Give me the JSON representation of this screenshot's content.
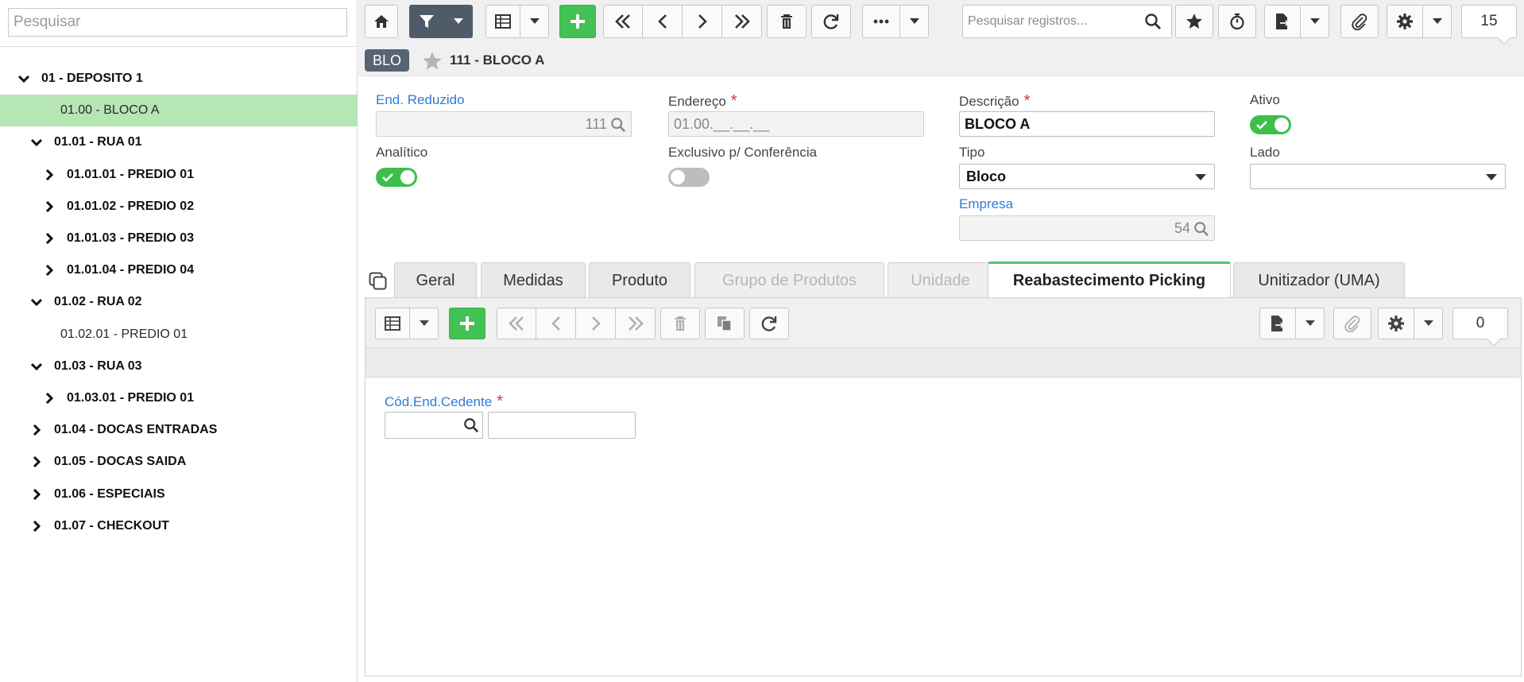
{
  "sidebar": {
    "search_placeholder": "Pesquisar",
    "tree": [
      {
        "label": "01 - DEPOSITO 1",
        "expanded": true,
        "bold": true,
        "level": 0
      },
      {
        "label": "01.00 - BLOCO A",
        "selected": true,
        "bold": false,
        "level": 1
      },
      {
        "label": "01.01 - RUA 01",
        "expanded": true,
        "bold": true,
        "level": 1
      },
      {
        "label": "01.01.01 - PREDIO 01",
        "expanded": false,
        "bold": true,
        "level": 2
      },
      {
        "label": "01.01.02 - PREDIO 02",
        "expanded": false,
        "bold": true,
        "level": 2
      },
      {
        "label": "01.01.03 - PREDIO 03",
        "expanded": false,
        "bold": true,
        "level": 2
      },
      {
        "label": "01.01.04 - PREDIO 04",
        "expanded": false,
        "bold": true,
        "level": 2
      },
      {
        "label": "01.02 - RUA 02",
        "expanded": true,
        "bold": true,
        "level": 1
      },
      {
        "label": "01.02.01 - PREDIO 01",
        "bold": false,
        "level": 2
      },
      {
        "label": "01.03 - RUA 03",
        "expanded": true,
        "bold": true,
        "level": 1
      },
      {
        "label": "01.03.01 - PREDIO 01",
        "expanded": false,
        "bold": true,
        "level": 2
      },
      {
        "label": "01.04 - DOCAS ENTRADAS",
        "expanded": false,
        "bold": true,
        "level": 1
      },
      {
        "label": "01.05 - DOCAS SAIDA",
        "expanded": false,
        "bold": true,
        "level": 1
      },
      {
        "label": "01.06 - ESPECIAIS",
        "expanded": false,
        "bold": true,
        "level": 1
      },
      {
        "label": "01.07 - CHECKOUT",
        "expanded": false,
        "bold": true,
        "level": 1
      }
    ]
  },
  "toolbar": {
    "icons": [
      "home-icon",
      "filter-icon",
      "grid-icon",
      "plus-icon",
      "first-icon",
      "prev-icon",
      "next-icon",
      "last-icon",
      "trash-icon",
      "refresh-icon",
      "more-icon",
      "star-icon",
      "timer-icon",
      "export-icon",
      "paperclip-icon",
      "gear-icon"
    ],
    "search_placeholder": "Pesquisar registros...",
    "page_count": "15"
  },
  "header": {
    "badge": "BLO",
    "title": "111 - BLOCO A"
  },
  "form": {
    "end_reduzido_label": "End. Reduzido",
    "end_reduzido_value": "111",
    "endereco_label": "Endereço",
    "endereco_value": "01.00.__.__.__",
    "descricao_label": "Descrição",
    "descricao_value": "BLOCO A",
    "ativo_label": "Ativo",
    "ativo_on": true,
    "analitico_label": "Analítico",
    "analitico_on": true,
    "exclusivo_label": "Exclusivo p/ Conferência",
    "exclusivo_on": false,
    "tipo_label": "Tipo",
    "tipo_value": "Bloco",
    "lado_label": "Lado",
    "lado_value": "",
    "empresa_label": "Empresa",
    "empresa_value": "54",
    "required_mark": "*"
  },
  "tabs": [
    {
      "label": "Geral",
      "state": "normal"
    },
    {
      "label": "Medidas",
      "state": "normal"
    },
    {
      "label": "Produto",
      "state": "normal"
    },
    {
      "label": "Grupo de Produtos",
      "state": "disabled"
    },
    {
      "label": "Unidade",
      "state": "disabled"
    },
    {
      "label": "Reabastecimento Picking",
      "state": "active"
    },
    {
      "label": "Unitizador (UMA)",
      "state": "normal"
    }
  ],
  "subpanel": {
    "count": "0",
    "cod_end_cedente_label": "Cód.End.Cedente",
    "cod_end_cedente_value": "",
    "cod_end_cedente_desc": ""
  },
  "colors": {
    "accent_green": "#41c253",
    "selected_row": "#b5e6b4",
    "dark_button": "#4f5b68",
    "link_blue": "#2e7bd8",
    "required_red": "#e03030"
  }
}
